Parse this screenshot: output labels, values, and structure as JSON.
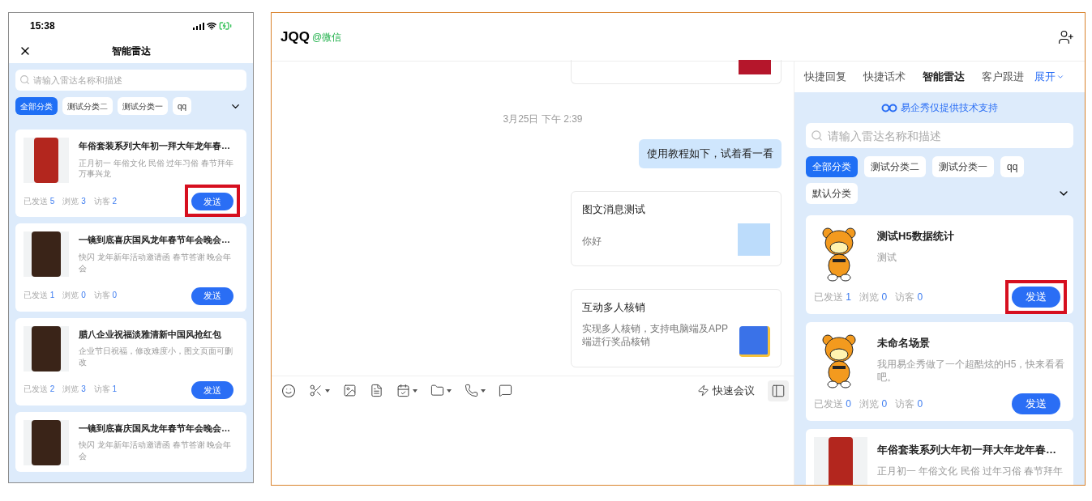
{
  "phone": {
    "time": "15:38",
    "title": "智能雷达",
    "search": {
      "placeholder": "请输入雷达名称和描述"
    },
    "categories": [
      {
        "label": "全部分类",
        "selected": true
      },
      {
        "label": "测试分类二",
        "selected": false
      },
      {
        "label": "测试分类一",
        "selected": false
      },
      {
        "label": "qq",
        "selected": false
      }
    ],
    "cards": [
      {
        "kind": "red-poster",
        "title": "年俗套装系列大年初一拜大年龙年春…",
        "description": "正月初一 年俗文化 民俗 过年习俗 春节拜年万事兴龙",
        "stats": [
          {
            "label": "已发送",
            "value": "5"
          },
          {
            "label": "浏览",
            "value": "3"
          },
          {
            "label": "访客",
            "value": "2"
          }
        ],
        "button": "发送",
        "highlighted": true
      },
      {
        "kind": "dark-poster",
        "title": "一镜到底喜庆国风龙年春节年会晚会…",
        "description": "快闪 龙年新年活动邀请函 春节答谢 晚会年会",
        "stats": [
          {
            "label": "已发送",
            "value": "1"
          },
          {
            "label": "浏览",
            "value": "0"
          },
          {
            "label": "访客",
            "value": "0"
          }
        ],
        "button": "发送"
      },
      {
        "kind": "dark-poster",
        "title": "腊八企业祝福淡雅清新中国风抢红包",
        "description": "企业节日祝福，修改难度小，图文页面可删改",
        "stats": [
          {
            "label": "已发送",
            "value": "2"
          },
          {
            "label": "浏览",
            "value": "3"
          },
          {
            "label": "访客",
            "value": "1"
          }
        ],
        "button": "发送"
      },
      {
        "kind": "dark-poster",
        "title": "一镜到底喜庆国风龙年春节年会晚会…",
        "description": "快闪 龙年新年活动邀请函 春节答谢 晚会年会"
      }
    ]
  },
  "chat": {
    "contact": "JQQ",
    "source": "@微信",
    "messages": [
      {
        "kind": "card-partial"
      },
      {
        "kind": "time",
        "text": "3月25日 下午 2:39"
      },
      {
        "kind": "bubble",
        "text": "使用教程如下，试着看一看"
      },
      {
        "kind": "card-flowchart",
        "title": "图文消息测试",
        "description": "你好"
      },
      {
        "kind": "card-badge",
        "title": "互动多人核销",
        "description": "实现多人核销，支持电脑端及APP端进行奖品核销"
      }
    ],
    "meeting_button": "快速会议"
  },
  "panel": {
    "tabs": [
      {
        "label": "快捷回复",
        "selected": false
      },
      {
        "label": "快捷话术",
        "selected": false
      },
      {
        "label": "智能雷达",
        "selected": true
      },
      {
        "label": "客户跟进",
        "selected": false
      }
    ],
    "expand": "展开",
    "support_note": "易企秀仅提供技术支持",
    "search": {
      "placeholder": "请输入雷达名称和描述"
    },
    "categories": [
      {
        "label": "全部分类",
        "selected": true
      },
      {
        "label": "测试分类二",
        "selected": false
      },
      {
        "label": "测试分类一",
        "selected": false
      },
      {
        "label": "qq",
        "selected": false
      },
      {
        "label": "默认分类",
        "selected": false
      }
    ],
    "cards": [
      {
        "kind": "mascot",
        "title": "测试H5数据统计",
        "description": "测试",
        "stats": [
          {
            "label": "已发送",
            "value": "1"
          },
          {
            "label": "浏览",
            "value": "0"
          },
          {
            "label": "访客",
            "value": "0"
          }
        ],
        "button": "发送",
        "highlighted": true
      },
      {
        "kind": "mascot",
        "title": "未命名场景",
        "description": "我用易企秀做了一个超酷炫的H5，快来看看吧。",
        "stats": [
          {
            "label": "已发送",
            "value": "0"
          },
          {
            "label": "浏览",
            "value": "0"
          },
          {
            "label": "访客",
            "value": "0"
          }
        ],
        "button": "发送"
      },
      {
        "kind": "red-poster",
        "title": "年俗套装系列大年初一拜大年龙年春…",
        "description": "正月初一 年俗文化 民俗 过年习俗 春节拜年"
      }
    ]
  }
}
